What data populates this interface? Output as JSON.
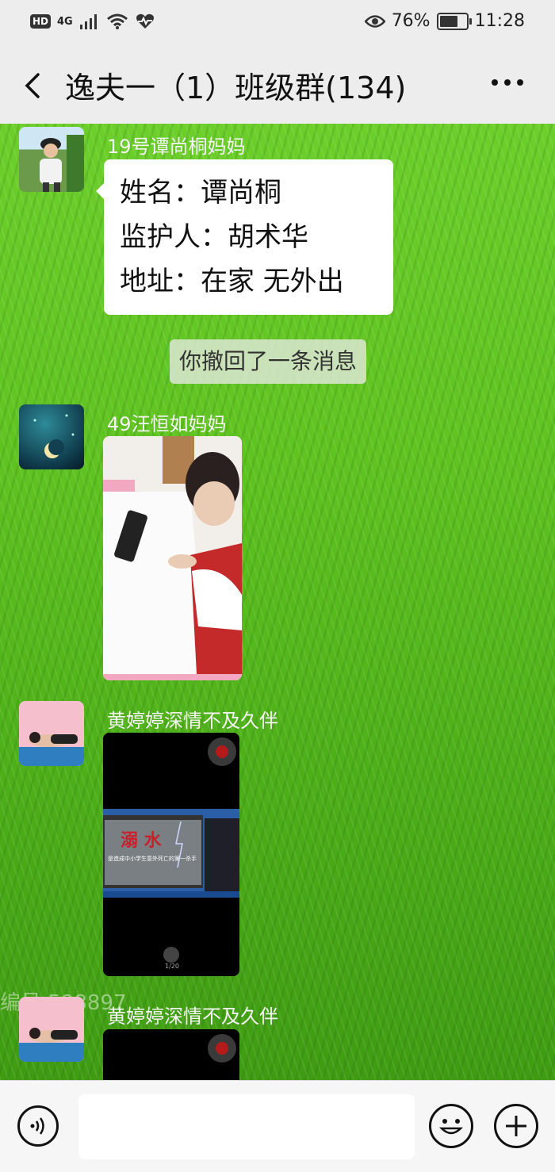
{
  "status_bar": {
    "hd": "HD",
    "network": "4G",
    "eye_icon": "eye-icon",
    "battery_percent": "76%",
    "battery_level": 0.76,
    "time": "11:28"
  },
  "nav": {
    "title": "逸夫一（1）班级群(134)",
    "back_icon": "chevron-left-icon",
    "more_icon": "more-icon"
  },
  "messages": [
    {
      "sender": "19号谭尚桐妈妈",
      "lines": [
        "姓名：谭尚桐",
        "监护人：胡术华",
        "地址：在家  无外出"
      ]
    },
    {
      "system": "你撤回了一条消息"
    },
    {
      "sender": "49汪恒如妈妈",
      "image": "photo-child-with-phone"
    },
    {
      "sender": "黄婷婷深情不及久伴",
      "image": "video-screenshot",
      "video_title": "溺 水",
      "video_caption": "是造成中小学生意外死亡的第一杀手",
      "video_page": "1/20"
    },
    {
      "sender": "黄婷婷深情不及久伴",
      "image": "video-screenshot"
    }
  ],
  "watermark": "编号 598897",
  "input_bar": {
    "voice_icon": "voice-icon",
    "emoji_icon": "emoji-icon",
    "plus_icon": "plus-icon",
    "input_value": ""
  },
  "colors": {
    "chat_bg": "#5fc320",
    "bubble": "#ffffff",
    "nav_bg": "#ededed"
  }
}
